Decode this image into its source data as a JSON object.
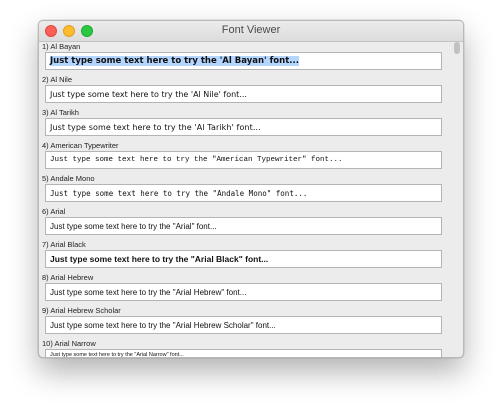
{
  "window": {
    "title": "Font Viewer"
  },
  "fonts": [
    {
      "label": "1) Al Bayan",
      "text": "Just type some text here to try the 'Al Bayan' font..."
    },
    {
      "label": "2) Al Nile",
      "text": "Just type some text here to try the 'Al Nile' font..."
    },
    {
      "label": "3) Al Tarikh",
      "text": "Just type some text here to try the 'Al Tarikh' font..."
    },
    {
      "label": "4) American Typewriter",
      "text": "Just type some text here to try the \"American Typewriter\" font..."
    },
    {
      "label": "5) Andale Mono",
      "text": "Just type some text here to try the \"Andale Mono\" font..."
    },
    {
      "label": "6) Arial",
      "text": "Just type some text here to try the \"Arial\" font..."
    },
    {
      "label": "7) Arial Black",
      "text": "Just type some text here to try the \"Arial Black\" font..."
    },
    {
      "label": "8) Arial Hebrew",
      "text": "Just type some text here to try the \"Arial Hebrew\" font..."
    },
    {
      "label": "9) Arial Hebrew Scholar",
      "text": "Just type some text here to try the \"Arial Hebrew Scholar\" font..."
    },
    {
      "label": "10) Arial Narrow",
      "text": "Just type some text here to try the \"Arial Narrow\" font..."
    }
  ]
}
